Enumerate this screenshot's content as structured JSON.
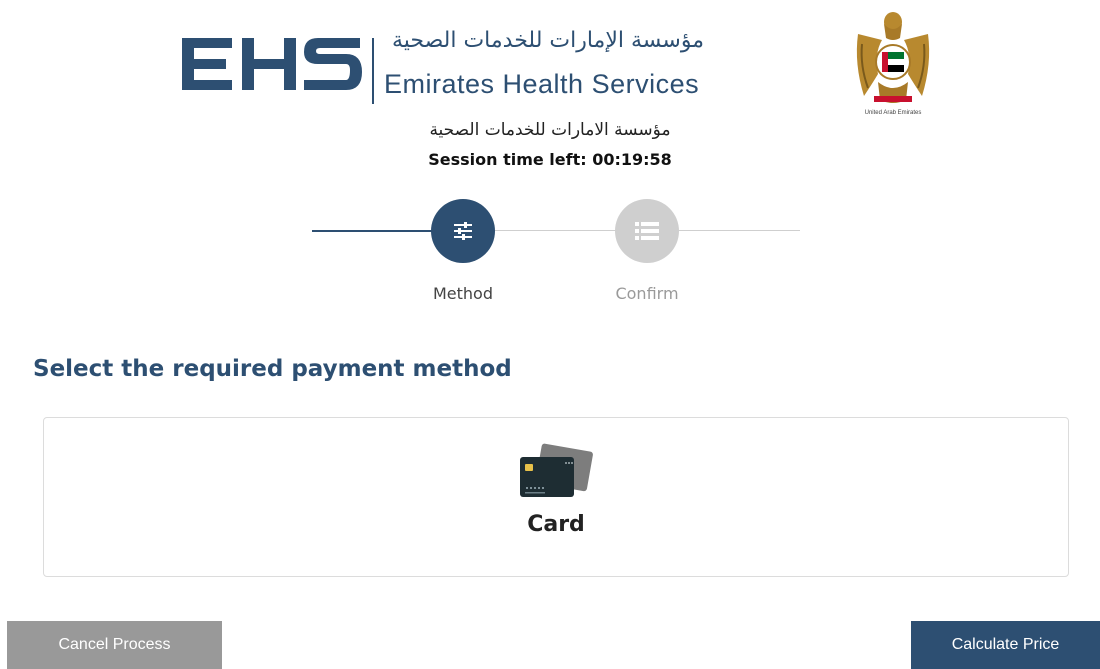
{
  "header": {
    "ehs_mark": "EHS",
    "logo_arabic": "مؤسسة الإمارات للخدمات الصحية",
    "logo_english": "Emirates Health Services",
    "emblem_caption": "United Arab Emirates",
    "org_name_arabic": "مؤسسة الامارات للخدمات الصحية",
    "session_timer": "Session time left: 00:19:58"
  },
  "stepper": {
    "steps": [
      {
        "label": "Method",
        "icon": "sliders-icon",
        "state": "active"
      },
      {
        "label": "Confirm",
        "icon": "list-icon",
        "state": "inactive"
      }
    ]
  },
  "main": {
    "title": "Select the required payment method",
    "methods": [
      {
        "label": "Card",
        "icon": "credit-card-icon"
      }
    ]
  },
  "actions": {
    "cancel_label": "Cancel Process",
    "calculate_label": "Calculate Price"
  },
  "colors": {
    "primary": "#2d4f72",
    "inactive": "#cfcfcf",
    "cancel": "#999999"
  }
}
